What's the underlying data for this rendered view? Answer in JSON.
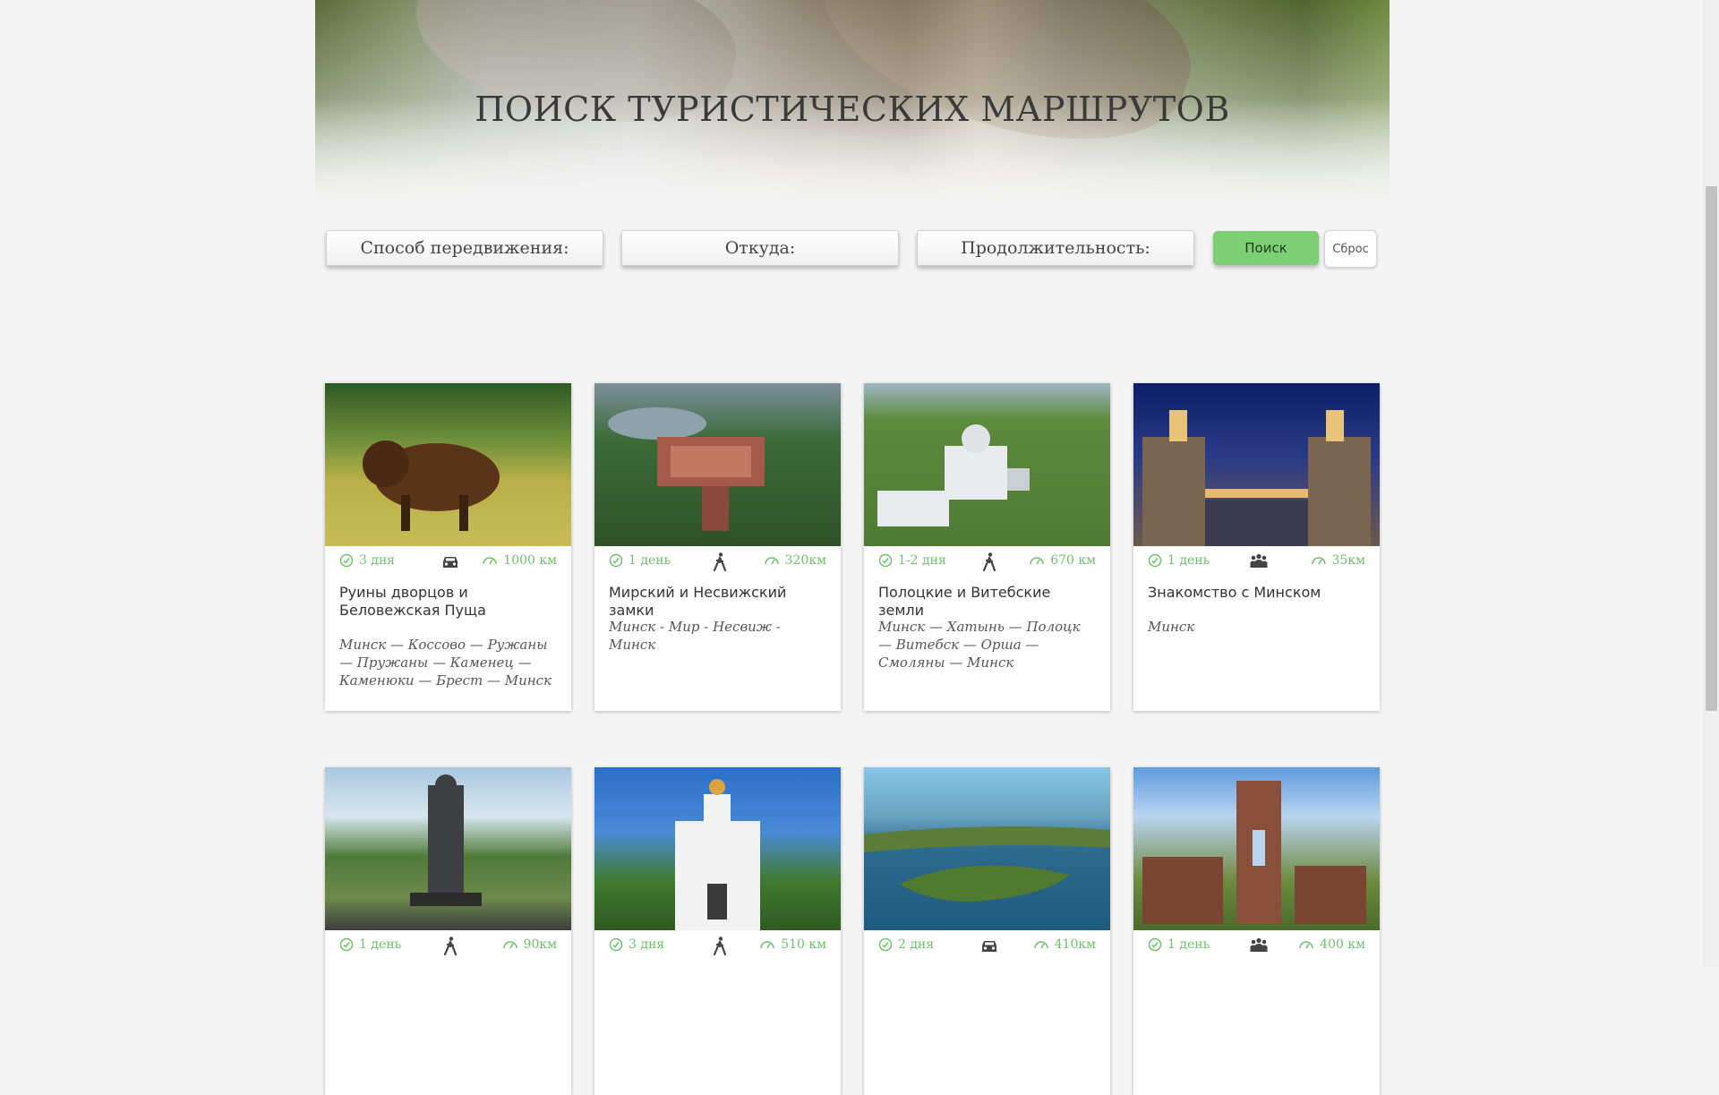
{
  "hero": {
    "title": "ПОИСК ТУРИСТИЧЕСКИХ МАРШРУТОВ"
  },
  "filters": {
    "transport": "Способ передвижения:",
    "from": "Откуда:",
    "duration": "Продолжительность:",
    "search_label": "Поиск",
    "reset_label": "Сброс"
  },
  "colors": {
    "accent": "#6cc16a",
    "search_button": "#7ccf73"
  },
  "routes": [
    {
      "title": "Руины дворцов и Беловежская Пуща",
      "duration": "3 дня",
      "distance": "1000 км",
      "mode": "car-icon",
      "route": "Минск — Коссово — Ружаны — Пружаны — Каменец — Каменюки — Брест — Минск"
    },
    {
      "title": "Мирский и Несвижский замки",
      "duration": "1 день",
      "distance": "320км",
      "mode": "walking-icon",
      "route": "Минск - Мир - Несвиж - Минск"
    },
    {
      "title": "Полоцкие и Витебские земли",
      "duration": "1-2 дня",
      "distance": "670 км",
      "mode": "walking-icon",
      "route": "Минск — Хатынь — Полоцк — Витебск — Орша — Смоляны — Минск"
    },
    {
      "title": "Знакомство с Минском",
      "duration": "1 день",
      "distance": "35км",
      "mode": "group-icon",
      "route": "Минск"
    },
    {
      "duration": "1 день",
      "distance": "90км",
      "mode": "walking-icon"
    },
    {
      "duration": "3 дня",
      "distance": "510 км",
      "mode": "walking-icon"
    },
    {
      "duration": "2 дня",
      "distance": "410км",
      "mode": "car-icon"
    },
    {
      "duration": "1 день",
      "distance": "400 км",
      "mode": "group-icon"
    }
  ]
}
